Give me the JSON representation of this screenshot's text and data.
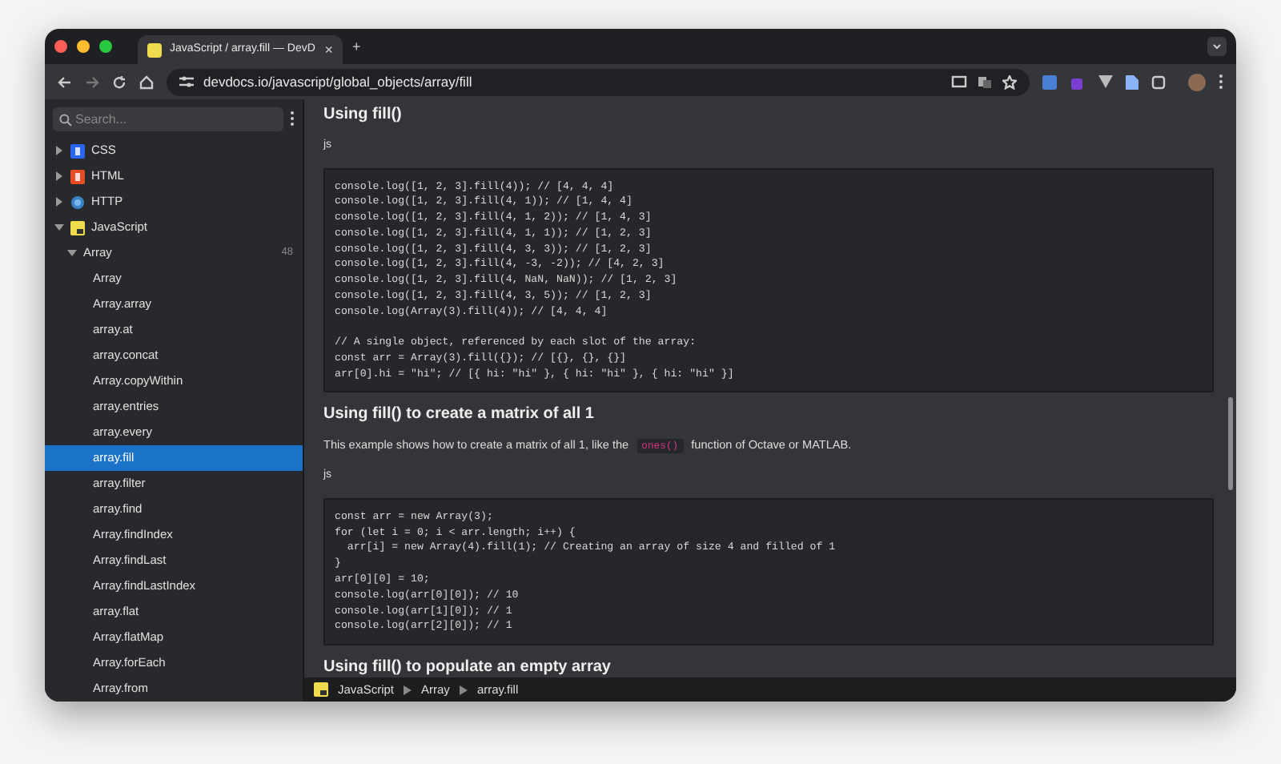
{
  "browser": {
    "tab": {
      "title": "JavaScript / array.fill — DevD",
      "close": "×"
    },
    "new_tab": "+",
    "url": "devdocs.io/javascript/global_objects/array/fill"
  },
  "sidebar": {
    "search": {
      "placeholder": "Search..."
    },
    "tree": [
      {
        "label": "CSS",
        "kind": "css",
        "expanded": false
      },
      {
        "label": "HTML",
        "kind": "html",
        "expanded": false
      },
      {
        "label": "HTTP",
        "kind": "http",
        "expanded": false
      },
      {
        "label": "JavaScript",
        "kind": "js",
        "expanded": true,
        "children": [
          {
            "label": "Array",
            "expanded": true,
            "count": "48",
            "children": [
              {
                "label": "Array",
                "selected": false
              },
              {
                "label": "Array.array",
                "selected": false
              },
              {
                "label": "array.at",
                "selected": false
              },
              {
                "label": "array.concat",
                "selected": false
              },
              {
                "label": "Array.copyWithin",
                "selected": false
              },
              {
                "label": "array.entries",
                "selected": false
              },
              {
                "label": "array.every",
                "selected": false
              },
              {
                "label": "array.fill",
                "selected": true
              },
              {
                "label": "array.filter",
                "selected": false
              },
              {
                "label": "array.find",
                "selected": false
              },
              {
                "label": "Array.findIndex",
                "selected": false
              },
              {
                "label": "Array.findLast",
                "selected": false
              },
              {
                "label": "Array.findLastIndex",
                "selected": false
              },
              {
                "label": "array.flat",
                "selected": false
              },
              {
                "label": "Array.flatMap",
                "selected": false
              },
              {
                "label": "Array.forEach",
                "selected": false
              },
              {
                "label": "Array.from",
                "selected": false
              }
            ]
          }
        ]
      }
    ]
  },
  "content": [
    {
      "kind": "heading",
      "text": "Using fill()"
    },
    {
      "kind": "label",
      "text": "js"
    },
    {
      "kind": "code",
      "groups": [
        [
          "console.log([1, 2, 3].fill(4)); // [4, 4, 4]",
          "console.log([1, 2, 3].fill(4, 1)); // [1, 4, 4]",
          "console.log([1, 2, 3].fill(4, 1, 2)); // [1, 4, 3]",
          "console.log([1, 2, 3].fill(4, 1, 1)); // [1, 2, 3]",
          "console.log([1, 2, 3].fill(4, 3, 3)); // [1, 2, 3]",
          "console.log([1, 2, 3].fill(4, -3, -2)); // [4, 2, 3]",
          "console.log([1, 2, 3].fill(4, NaN, NaN)); // [1, 2, 3]",
          "console.log([1, 2, 3].fill(4, 3, 5)); // [1, 2, 3]",
          "console.log(Array(3).fill(4)); // [4, 4, 4]"
        ],
        [
          "// A single object, referenced by each slot of the array:",
          "const arr = Array(3).fill({}); // [{}, {}, {}]",
          "arr[0].hi = \"hi\"; // [{ hi: \"hi\" }, { hi: \"hi\" }, { hi: \"hi\" }]"
        ]
      ]
    },
    {
      "kind": "heading",
      "text": "Using fill() to create a matrix of all 1"
    },
    {
      "kind": "paragraph",
      "parts": [
        {
          "text": "This example shows how to create a matrix of all 1, like the"
        },
        {
          "code": "ones()"
        },
        {
          "text": "function of Octave or MATLAB."
        }
      ]
    },
    {
      "kind": "label",
      "text": "js"
    },
    {
      "kind": "code",
      "groups": [
        [
          "const arr = new Array(3);",
          "for (let i = 0; i < arr.length; i++) {",
          "  arr[i] = new Array(4).fill(1); // Creating an array of size 4 and filled of 1",
          "}",
          "arr[0][0] = 10;",
          "console.log(arr[0][0]); // 10",
          "console.log(arr[1][0]); // 1",
          "console.log(arr[2][0]); // 1"
        ]
      ]
    },
    {
      "kind": "heading",
      "text": "Using fill() to populate an empty array"
    }
  ],
  "breadcrumb": [
    "JavaScript",
    "Array",
    "array.fill"
  ]
}
